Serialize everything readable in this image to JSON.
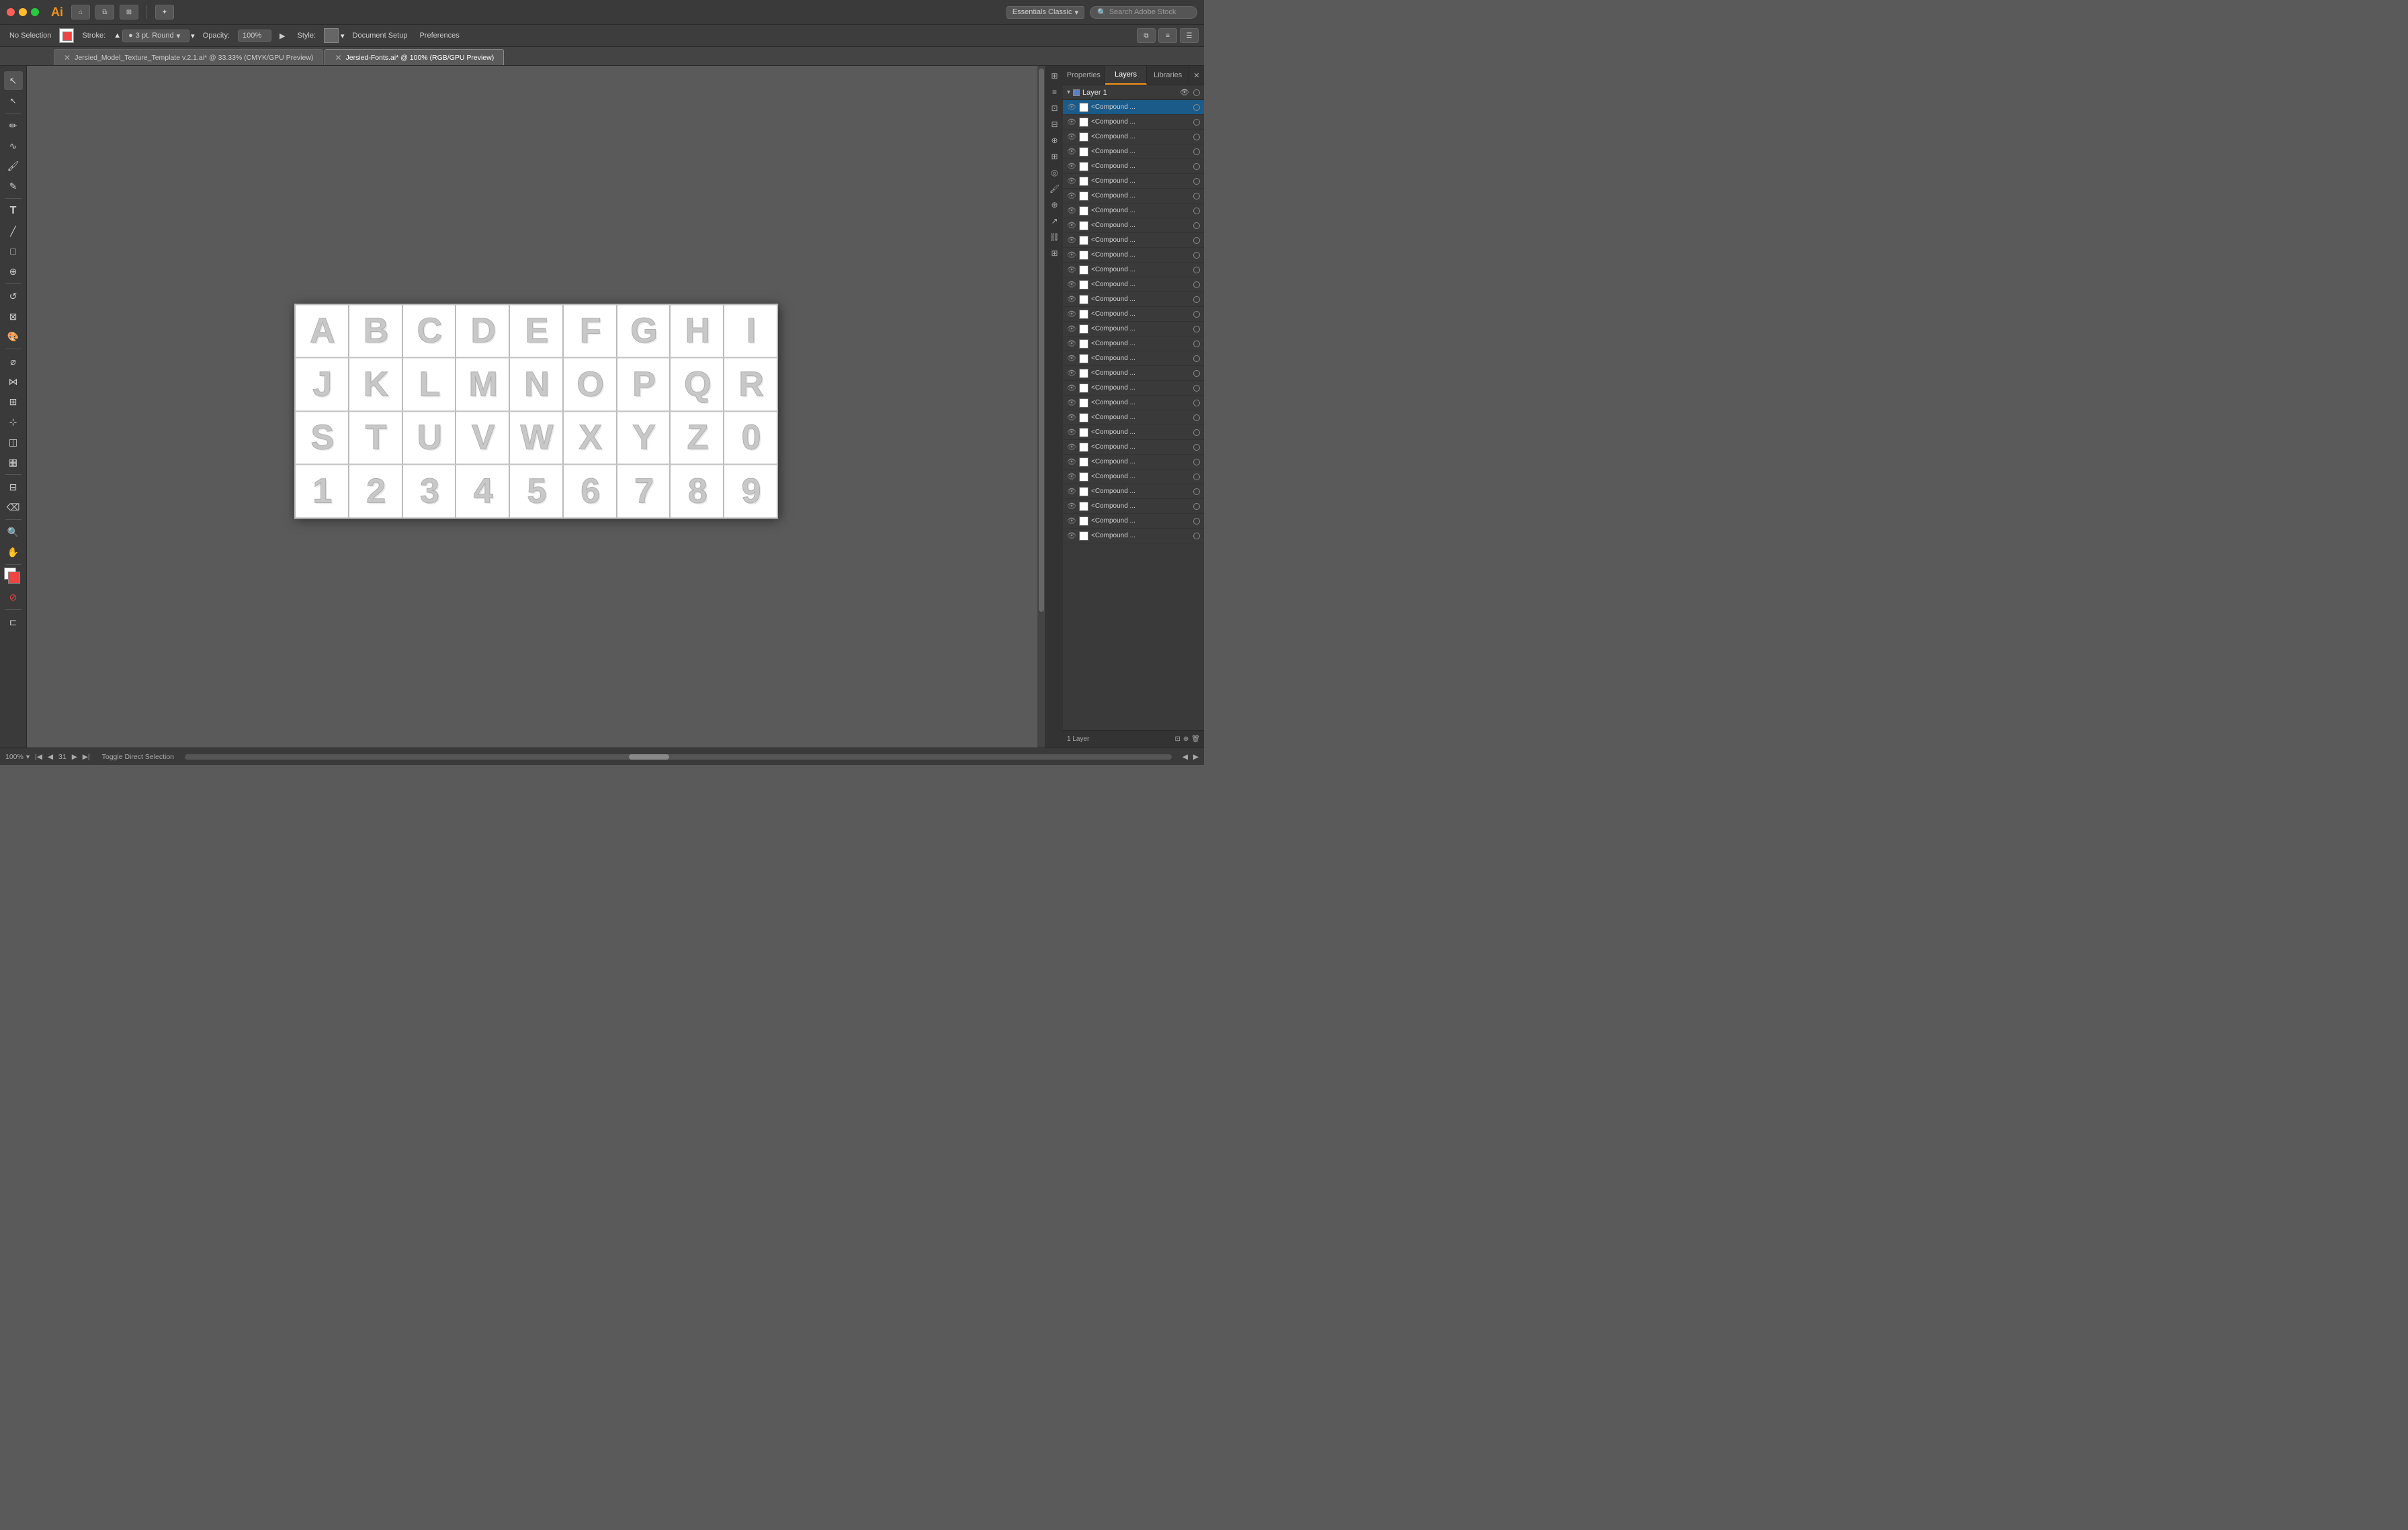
{
  "app": {
    "name": "Ai",
    "title": "Adobe Illustrator"
  },
  "titlebar": {
    "workspace": "Essentials Classic",
    "workspace_arrow": "▾",
    "search_placeholder": "Search Adobe Stock"
  },
  "toolbar": {
    "no_selection": "No Selection",
    "stroke_label": "Stroke:",
    "stroke_value": "3 pt. Round",
    "opacity_label": "Opacity:",
    "opacity_value": "100%",
    "style_label": "Style:",
    "document_setup": "Document Setup",
    "preferences": "Preferences"
  },
  "tabs": [
    {
      "id": "tab1",
      "label": "Jersied_Model_Texture_Template v.2.1.ai* @ 33.33% (CMYK/GPU Preview)",
      "active": false
    },
    {
      "id": "tab2",
      "label": "Jersied-Fonts.ai* @ 100% (RGB/GPU Preview)",
      "active": true
    }
  ],
  "panels": {
    "properties": "Properties",
    "layers": "Layers",
    "libraries": "Libraries"
  },
  "layers_panel": {
    "layer_name": "Layer 1",
    "items_count": 30,
    "compound_label": "<Compound ...",
    "layer_count_label": "1 Layer"
  },
  "canvas": {
    "zoom": "100%",
    "frame_current": "31",
    "toggle_label": "Toggle Direct Selection"
  },
  "font_grid": {
    "chars": [
      "A",
      "B",
      "C",
      "D",
      "E",
      "F",
      "G",
      "H",
      "I",
      "J",
      "K",
      "L",
      "M",
      "N",
      "O",
      "P",
      "Q",
      "R",
      "S",
      "T",
      "U",
      "V",
      "W",
      "X",
      "Y",
      "Z",
      "0",
      "1",
      "2",
      "3",
      "4",
      "5",
      "6",
      "7",
      "8",
      "9"
    ]
  },
  "colors": {
    "bg": "#5a5a5a",
    "titlebar": "#3a3a3a",
    "toolbar": "#3d3d3d",
    "panel": "#3a3a3a",
    "accent": "#f7941d",
    "layer_blue": "#5b7fbf",
    "selected_blue": "#1a5b8a",
    "artboard": "#ffffff"
  }
}
